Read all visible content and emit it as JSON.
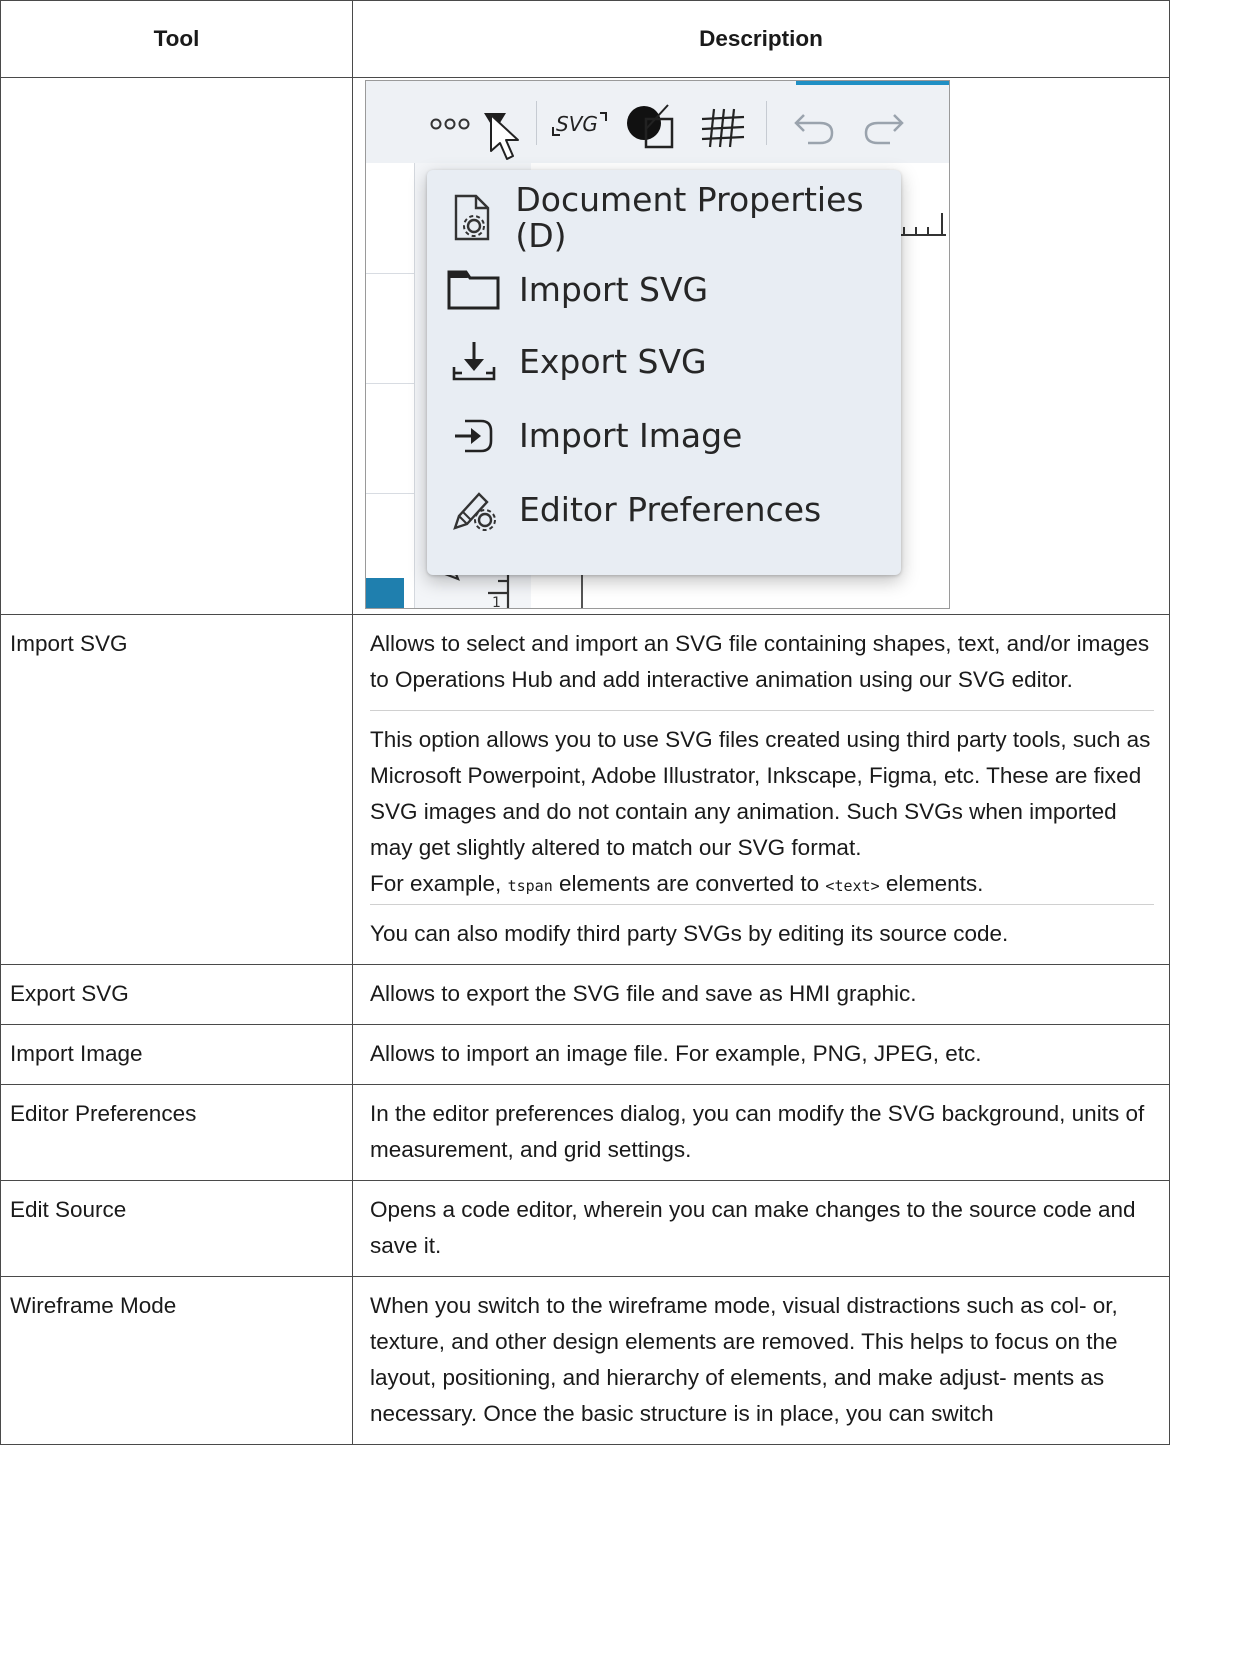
{
  "table": {
    "headers": {
      "tool": "Tool",
      "description": "Description"
    },
    "image_menu": {
      "items": [
        {
          "label": "Document Properties (D)",
          "icon": "document-gear-icon"
        },
        {
          "label": "Import SVG",
          "icon": "folder-icon"
        },
        {
          "label": "Export SVG",
          "icon": "export-download-icon"
        },
        {
          "label": "Import Image",
          "icon": "import-arrow-icon"
        },
        {
          "label": "Editor Preferences",
          "icon": "pen-gear-icon"
        }
      ],
      "toolbar": {
        "more": "ooo",
        "svg": "SVG",
        "colors": {
          "accent_blue": "#1f8fc4",
          "menu_bg": "#e8edf3"
        }
      }
    },
    "rows": [
      {
        "tool": "Import SVG",
        "paragraphs": [
          "Allows to select and import an SVG file containing shapes, text, and/or images to Operations Hub and add interactive animation using our SVG editor.",
          "This option allows you to use SVG files created using third party tools, such as Microsoft Powerpoint, Adobe Illustrator, Inkscape, Figma, etc. These are fixed SVG images and do not contain any animation. Such SVGs when imported may get slightly altered to match our SVG format.",
          "You can also modify third party SVGs by editing its source code."
        ],
        "example": {
          "prefix": "For example,",
          "code1": "tspan",
          "middle": "elements are converted to",
          "code2": "<text>",
          "suffix": "elements."
        }
      },
      {
        "tool": "Export SVG",
        "description": "Allows to export the SVG file and save as HMI graphic."
      },
      {
        "tool": "Import Image",
        "description": "Allows to import an image file. For example, PNG, JPEG, etc."
      },
      {
        "tool": "Editor Preferences",
        "description": "In the editor preferences dialog, you can modify the SVG background, units of measurement, and grid settings."
      },
      {
        "tool": "Edit Source",
        "description": "Opens a code editor, wherein you can make changes to the source code and save it."
      },
      {
        "tool": "Wireframe Mode",
        "description": "When you switch to the wireframe mode, visual distractions such as col- or, texture, and other design elements are removed. This helps to focus on the layout, positioning, and hierarchy of elements, and make adjust- ments as necessary. Once the basic structure is in place, you can switch"
      }
    ]
  }
}
